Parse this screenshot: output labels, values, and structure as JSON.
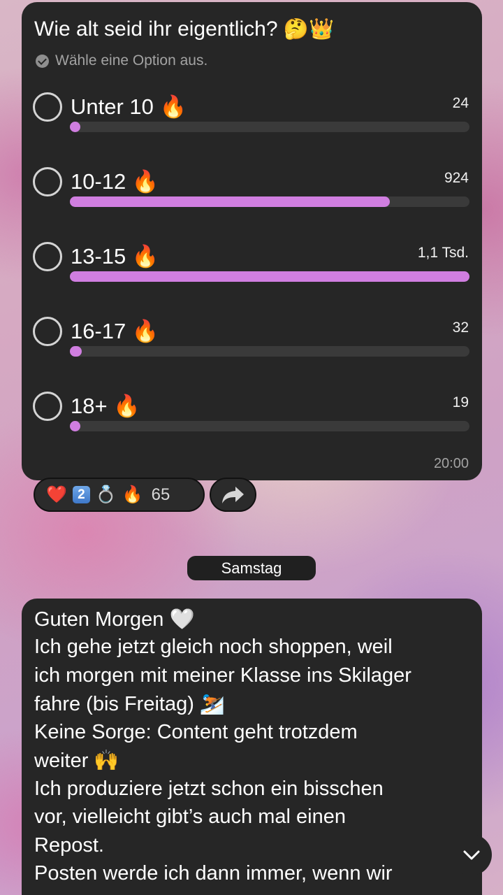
{
  "poll": {
    "question": "Wie alt seid ihr eigentlich?",
    "question_emoji": "🤔👑",
    "hint": "Wähle eine Option aus.",
    "options": [
      {
        "label": "Unter 10 🔥",
        "count": "24",
        "fraction": 0.022
      },
      {
        "label": "10-12 🔥",
        "count": "924",
        "fraction": 0.8
      },
      {
        "label": "13-15 🔥",
        "count": "1,1 Tsd.",
        "fraction": 1.0
      },
      {
        "label": "16-17 🔥",
        "count": "32",
        "fraction": 0.029
      },
      {
        "label": "18+ 🔥",
        "count": "19",
        "fraction": 0.017
      }
    ],
    "time": "20:00",
    "accent_color": "#d07ee0"
  },
  "reactions": {
    "emoji": [
      "❤️",
      "2",
      "💍",
      "🔥"
    ],
    "count": "65"
  },
  "date_separator": "Samstag",
  "message": {
    "lines": [
      "Guten Morgen 🤍",
      "Ich gehe jetzt gleich noch shoppen, weil",
      "ich morgen mit meiner Klasse ins Skilager",
      "fahre (bis Freitag) ⛷️",
      "Keine Sorge: Content geht trotzdem",
      "weiter 🙌",
      "Ich produziere jetzt schon ein bisschen",
      "vor, vielleicht gibt’s auch mal einen",
      "Repost.",
      "Posten werde ich dann immer, wenn wir"
    ]
  },
  "icons": {
    "forward": "forward-arrow-icon",
    "scroll_down": "chevron-down-icon"
  }
}
